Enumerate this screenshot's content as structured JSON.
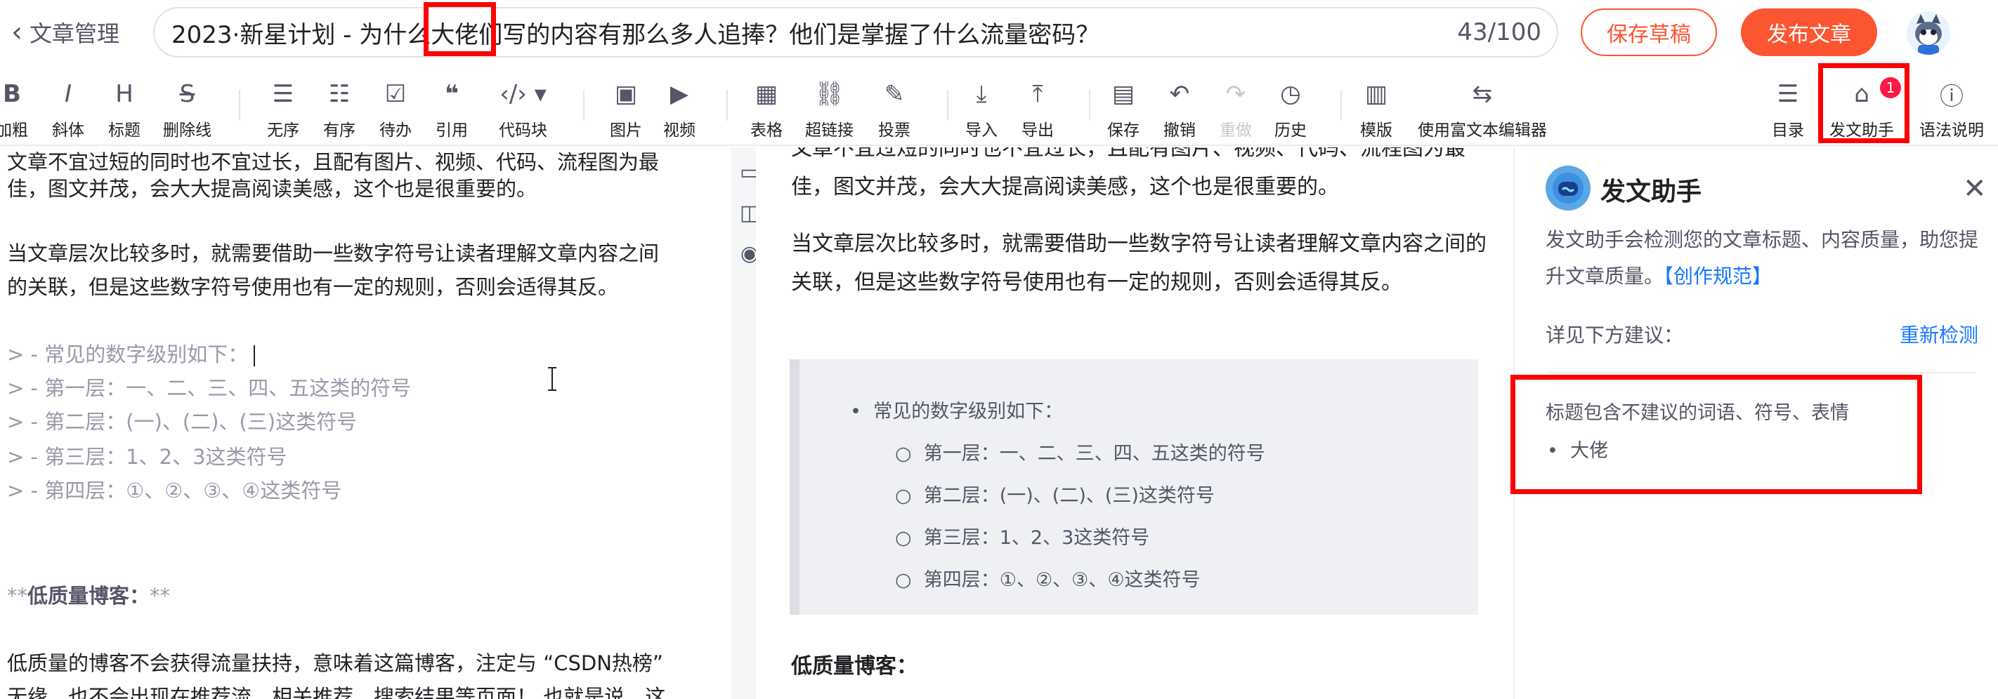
{
  "header": {
    "back_label": "文章管理",
    "title_prefix": "2023·新星计划 - 为什么",
    "title_highlight": "大佬",
    "title_suffix": "们写的内容有那么多人追捧？他们是掌握了什么流量密码？",
    "title_count": "43/100",
    "save_draft_label": "保存草稿",
    "publish_label": "发布文章"
  },
  "toolbar": {
    "bold": "加粗",
    "italic": "斜体",
    "heading": "标题",
    "strike": "删除线",
    "ul": "无序",
    "ol": "有序",
    "todo": "待办",
    "quote": "引用",
    "code": "代码块",
    "image": "图片",
    "video": "视频",
    "table": "表格",
    "link": "超链接",
    "vote": "投票",
    "import": "导入",
    "export": "导出",
    "save": "保存",
    "undo": "撤销",
    "redo": "重做",
    "history": "历史",
    "template": "模版",
    "rich_editor": "使用富文本编辑器",
    "toc": "目录",
    "assistant": "发文助手",
    "assistant_badge": "1",
    "syntax": "语法说明"
  },
  "editor": {
    "lines": [
      "文章不宜过短的同时也不宜过长，且配有图片、视频、代码、流程图为最",
      "佳，图文并茂，会大大提高阅读美感，这个也是很重要的。",
      "当文章层次比较多时，就需要借助一些数字符号让读者理解文章内容之间",
      "的关联，但是这些数字符号使用也有一定的规则，否则会适得其反。",
      "> - 常见的数字级别如下：",
      "> - 第一层：一、二、三、四、五这类的符号",
      "> - 第二层：(一)、(二)、(三)这类符号",
      "> - 第三层：1、2、3这类符号",
      "> - 第四层：①、②、③、④这类符号",
      "低质量博客：",
      "低质量的博客不会获得流量扶持，意味着这篇博客，注定与 “CSDN热榜”",
      "无缘，也不会出现在推荐流、相关推荐、搜索结果等页面！ 也就是说，这"
    ],
    "bold_open": "**",
    "bold_close": "**"
  },
  "preview": {
    "para1": "文章不宜过短的同时也不宜过长，且配有图片、视频、代码、流程图为最佳，图文并茂，会大大提高阅读美感，这个也是很重要的。",
    "para2": "当文章层次比较多时，就需要借助一些数字符号让读者理解文章内容之间的关联，但是这些数字符号使用也有一定的规则，否则会适得其反。",
    "list_head": "常见的数字级别如下：",
    "sub_items": [
      "第一层：一、二、三、四、五这类的符号",
      "第二层：(一)、(二)、(三)这类符号",
      "第三层：1、2、3这类符号",
      "第四层：①、②、③、④这类符号"
    ],
    "heading": "低质量博客："
  },
  "assistant": {
    "title": "发文助手",
    "desc": "发文助手会检测您的文章标题、内容质量，助您提升文章质量。",
    "link": "【创作规范】",
    "suggest_label": "详见下方建议：",
    "recheck_label": "重新检测",
    "issue_title": "标题包含不建议的词语、符号、表情",
    "issue_item": "大佬"
  },
  "colors": {
    "brand": "#fc5531",
    "link": "#1677ff",
    "highlight": "#ff0000",
    "badge": "#fc1944"
  }
}
